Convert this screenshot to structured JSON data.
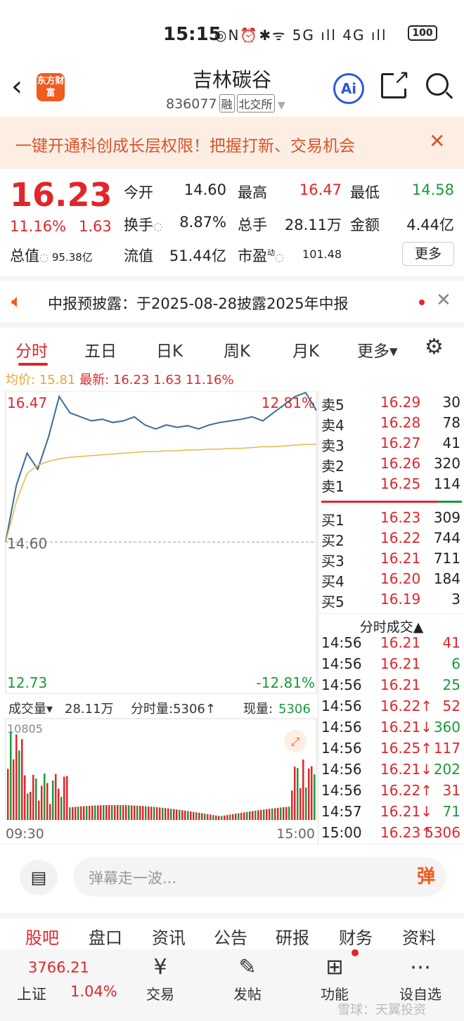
{
  "status": {
    "time": "15:15",
    "icons": "◎N⏰✱ᯤ 5G ıll 4G ıll",
    "battery": "100"
  },
  "header": {
    "logo_text": "东方财富",
    "stock_name": "吉林碳谷",
    "stock_code": "836077",
    "tag1": "融",
    "tag2": "北交所",
    "ai_label": "Ai"
  },
  "banner": {
    "text": "一键开通科创成长层权限！把握打新、交易机会",
    "close": "✕"
  },
  "quote": {
    "price": "16.23",
    "change_pct": "11.16%",
    "change": "1.63",
    "open_label": "今开",
    "open": "14.60",
    "high_label": "最高",
    "high": "16.47",
    "low_label": "最低",
    "low": "14.58",
    "turnover_label": "换手",
    "turnover": "8.87%",
    "volume_label": "总手",
    "volume": "28.11万",
    "amount_label": "金额",
    "amount": "4.44亿",
    "mcap_label": "总值",
    "mcap": "95.38亿",
    "float_label": "流值",
    "float": "51.44亿",
    "pe_label": "市盈",
    "pe_sup": "动",
    "pe": "101.48",
    "more": "更多"
  },
  "notice": {
    "text": "中报预披露：于2025-08-28披露2025年中报",
    "close": "✕"
  },
  "tabs": [
    "分时",
    "五日",
    "日K",
    "周K",
    "月K",
    "更多▾"
  ],
  "avg": {
    "avg_label": "均价:",
    "avg": "15.81",
    "latest_label": "最新:",
    "latest": "16.23",
    "chg": "1.63",
    "pct": "11.16%"
  },
  "chart_labels": {
    "top_left": "16.47",
    "top_right": "12.81%",
    "mid_left": "14.60",
    "bottom_left": "12.73",
    "bottom_right": "-12.81%",
    "vol_label": "成交量▾",
    "vol_total": "28.11万",
    "vol_tick": "分时量:5306↑",
    "vol_now_label": "现量:",
    "vol_now": "5306",
    "vol_max": "10805",
    "time_start": "09:30",
    "time_end": "15:00"
  },
  "colors": {
    "price_line": "#3a6a9a",
    "avg_line": "#e6b84a",
    "up": "#e0262b",
    "down": "#1a9a3a",
    "accent": "#f25a1e"
  },
  "chart_data": {
    "type": "line",
    "title": "",
    "xlabel": "",
    "ylabel": "",
    "ylim": [
      12.73,
      16.47
    ],
    "x": [
      "09:30",
      "15:00"
    ],
    "series": [
      {
        "values": [
          14.6,
          15.3,
          15.7,
          15.5,
          15.9,
          16.4,
          16.2,
          16.15,
          16.1,
          16.12,
          16.08,
          16.1,
          16.15,
          16.05,
          16.0,
          16.05,
          16.02,
          16.04,
          16.0,
          16.05,
          16.08,
          16.1,
          16.12,
          16.15,
          16.1,
          16.2,
          16.3,
          16.4,
          16.45,
          16.23
        ]
      },
      {
        "values": [
          14.6,
          15.1,
          15.45,
          15.55,
          15.6,
          15.63,
          15.65,
          15.66,
          15.67,
          15.68,
          15.69,
          15.7,
          15.71,
          15.72,
          15.72,
          15.73,
          15.73,
          15.74,
          15.74,
          15.75,
          15.75,
          15.76,
          15.76,
          15.77,
          15.78,
          15.78,
          15.79,
          15.8,
          15.81,
          15.81
        ]
      }
    ],
    "volume_max": 10805
  },
  "orderbook": {
    "asks": [
      {
        "label": "卖5",
        "price": "16.29",
        "vol": "30"
      },
      {
        "label": "卖4",
        "price": "16.28",
        "vol": "78"
      },
      {
        "label": "卖3",
        "price": "16.27",
        "vol": "41"
      },
      {
        "label": "卖2",
        "price": "16.26",
        "vol": "320"
      },
      {
        "label": "卖1",
        "price": "16.25",
        "vol": "114"
      }
    ],
    "bids": [
      {
        "label": "买1",
        "price": "16.23",
        "vol": "309"
      },
      {
        "label": "买2",
        "price": "16.22",
        "vol": "744"
      },
      {
        "label": "买3",
        "price": "16.21",
        "vol": "711"
      },
      {
        "label": "买4",
        "price": "16.20",
        "vol": "184"
      },
      {
        "label": "买5",
        "price": "16.19",
        "vol": "3"
      }
    ],
    "trades_title": "分时成交▲",
    "trades": [
      {
        "t": "14:56",
        "p": "16.21",
        "v": "41",
        "c": "red"
      },
      {
        "t": "14:56",
        "p": "16.21",
        "v": "6",
        "c": "green"
      },
      {
        "t": "14:56",
        "p": "16.21",
        "v": "25",
        "c": "green"
      },
      {
        "t": "14:56",
        "p": "16.22↑",
        "v": "52",
        "c": "red"
      },
      {
        "t": "14:56",
        "p": "16.21↓",
        "v": "360",
        "c": "green"
      },
      {
        "t": "14:56",
        "p": "16.25↑",
        "v": "117",
        "c": "red"
      },
      {
        "t": "14:56",
        "p": "16.21↓",
        "v": "202",
        "c": "green"
      },
      {
        "t": "14:56",
        "p": "16.22↑",
        "v": "31",
        "c": "red"
      },
      {
        "t": "14:57",
        "p": "16.21↓",
        "v": "71",
        "c": "green"
      },
      {
        "t": "15:00",
        "p": "16.23↑",
        "v": "5306",
        "c": "red"
      }
    ]
  },
  "barrage": {
    "placeholder": "弹幕走一波...",
    "btn": "弹"
  },
  "footer_tabs": [
    "股吧",
    "盘口",
    "资讯",
    "公告",
    "研报",
    "财务",
    "资料"
  ],
  "nav": {
    "index_value": "3766.21",
    "index_name": "上证",
    "index_change": "1.04%",
    "items": [
      {
        "label": "交易",
        "icon": "¥"
      },
      {
        "label": "发帖",
        "icon": "✎"
      },
      {
        "label": "功能",
        "icon": "⊞"
      },
      {
        "label": "设自选",
        "icon": "⋯"
      }
    ],
    "watermark": "雪球：天翼投资"
  }
}
